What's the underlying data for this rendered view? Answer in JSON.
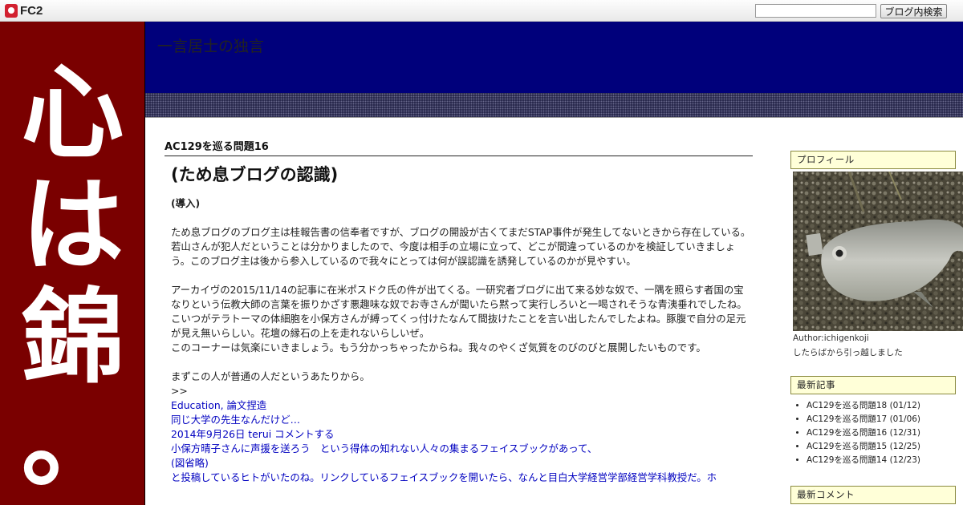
{
  "topbar": {
    "logo_text": "FC2",
    "search_placeholder": "",
    "search_button": "ブログ内検索"
  },
  "banner": {
    "characters": [
      "心",
      "は",
      "錦",
      "。"
    ]
  },
  "header": {
    "title": "一言居士の独言"
  },
  "article": {
    "entry_title": "AC129を巡る問題16",
    "heading": "(ため息ブログの認識)",
    "lead": "(導入)",
    "paragraphs": [
      "ため息ブログのブログ主は桂報告書の信奉者ですが、ブログの開設が古くてまだSTAP事件が発生してないときから存在している。",
      "若山さんが犯人だということは分かりましたので、今度は相手の立場に立って、どこが間違っているのかを検証していきましょう。このブログ主は後から参入しているので我々にとっては何が誤認識を誘発しているのかが見やすい。",
      "アーカイヴの2015/11/14の記事に在米ポスドク氏の件が出てくる。一研究者ブログに出て来る妙な奴で、一隅を照らす者国の宝なりという伝教大師の言葉を振りかざす悪趣味な奴でお寺さんが聞いたら黙って実行しろいと一喝されそうな青洟垂れでしたね。こいつがテラトーマの体細胞を小保方さんが縛ってくっ付けたなんて間抜けたことを言い出したんでしたよね。豚腹で自分の足元が見え無いらしい。花壇の縁石の上を走れないらしいぜ。",
      "このコーナーは気楽にいきましょう。もう分かっちゃったからね。我々のやくざ気質をのびのびと展開したいものです。",
      "まずこの人が普通の人だというあたりから。",
      ">>"
    ],
    "quote_lines": [
      "Education, 論文捏造",
      "同じ大学の先生なんだけど…",
      "2014年9月26日 terui コメントする",
      "小保方晴子さんに声援を送ろう　という得体の知れない人々の集まるフェイスブックがあって、",
      "(図省略)",
      "と投稿しているヒトがいたのね。リンクしているフェイスブックを開いたら、なんと目白大学経営学部経営学科教授だ。ホ"
    ]
  },
  "sidebar": {
    "profile": {
      "heading": "プロフィール",
      "author": "Author:ichigenkoji",
      "note": "したらばから引っ越しました"
    },
    "recent_posts": {
      "heading": "最新記事",
      "items": [
        "AC129を巡る問題18 (01/12)",
        "AC129を巡る問題17 (01/06)",
        "AC129を巡る問題16 (12/31)",
        "AC129を巡る問題15 (12/25)",
        "AC129を巡る問題14 (12/23)"
      ]
    },
    "recent_comments": {
      "heading": "最新コメント"
    }
  },
  "colors": {
    "banner_red": "#7a0000",
    "header_navy": "#00007b",
    "sidebar_head_bg": "#ffffd8",
    "link_blue": "#0000c0"
  },
  "icons": [
    "fc2-logo-icon"
  ]
}
